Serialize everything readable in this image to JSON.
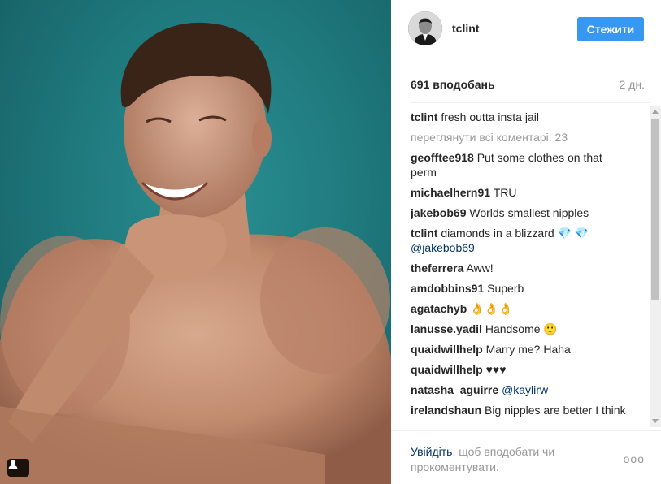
{
  "post": {
    "photo_alt": "tclint photo",
    "tag_icon": "person-tag-icon"
  },
  "header": {
    "username": "tclint",
    "follow_label": "Стежити",
    "accent_color": "#3897f0"
  },
  "stats": {
    "likes": "691 вподобань",
    "age": "2 дн."
  },
  "comments": {
    "caption": {
      "author": "tclint",
      "text": "fresh outta insta jail"
    },
    "view_all": "переглянути всі коментарі: 23",
    "items": [
      {
        "author": "geofftee918",
        "text": "Put some clothes on that perm"
      },
      {
        "author": "michaelhern91",
        "text": "TRU"
      },
      {
        "author": "jakebob69",
        "text": "Worlds smallest nipples"
      },
      {
        "author": "tclint",
        "text": "diamonds in a blizzard 💎 💎",
        "mention": "@jakebob69"
      },
      {
        "author": "theferrera",
        "text": "Aww!"
      },
      {
        "author": "amdobbins91",
        "text": "Superb"
      },
      {
        "author": "agatachyb",
        "text": "👌👌👌"
      },
      {
        "author": "lanusse.yadil",
        "text": "Handsome 🙂"
      },
      {
        "author": "quaidwillhelp",
        "text": "Marry me? Haha"
      },
      {
        "author": "quaidwillhelp",
        "text": "♥♥♥"
      },
      {
        "author": "natasha_aguirre",
        "text": "",
        "mention": "@kaylirw"
      },
      {
        "author": "irelandshaun",
        "text": "Big nipples are better I think"
      }
    ]
  },
  "footer": {
    "login_link": "Увійдіть",
    "login_rest": ", щоб вподобати чи прокоментувати.",
    "more_label": "ооо"
  }
}
